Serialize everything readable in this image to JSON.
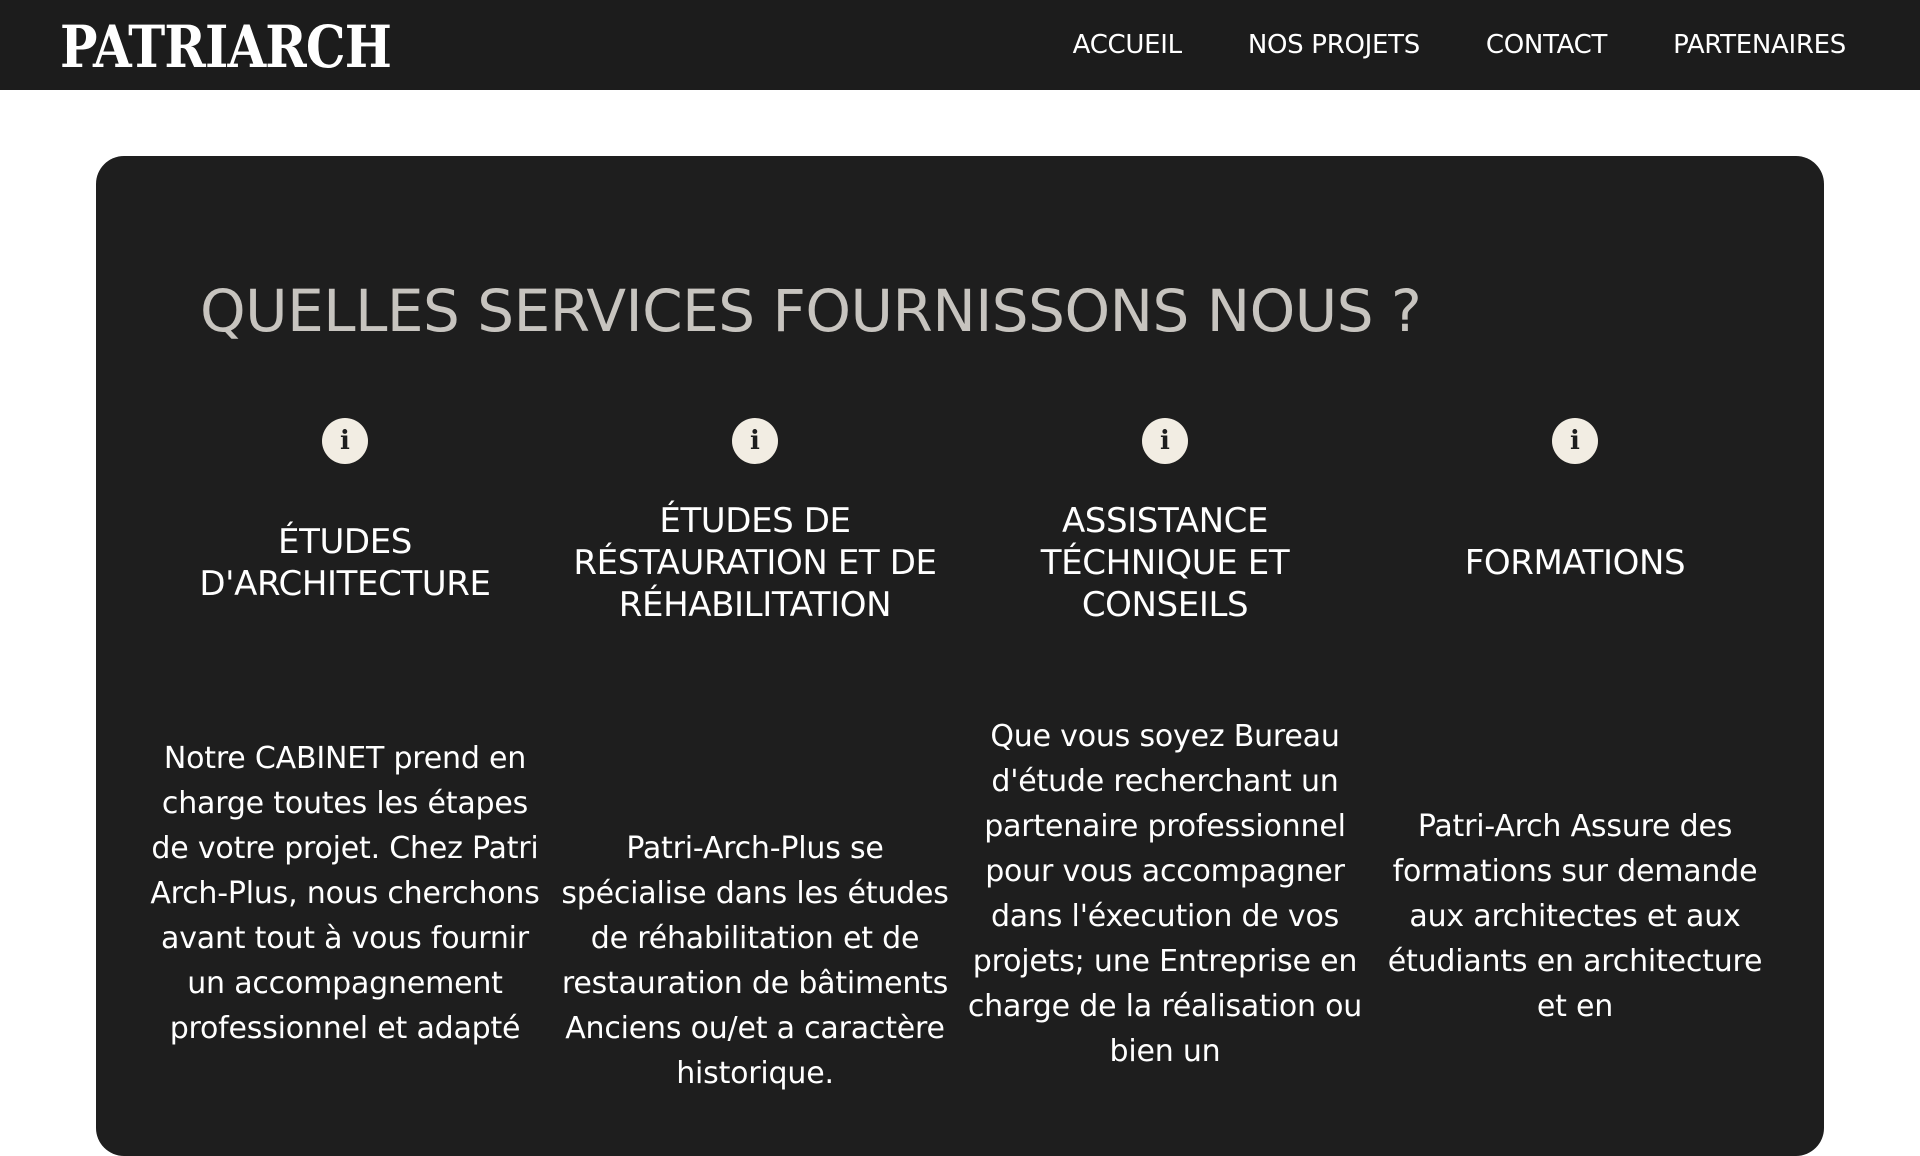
{
  "header": {
    "logo": "PATRIARCH",
    "nav": [
      "ACCUEIL",
      "NOS PROJETS",
      "CONTACT",
      "PARTENAIRES"
    ]
  },
  "services": {
    "title": "QUELLES SERVICES FOURNISSONS NOUS ?",
    "items": [
      {
        "icon": "info-icon",
        "title": "ÉTUDES D'ARCHITECTURE",
        "description": "Notre CABINET prend en charge toutes les étapes de votre projet. Chez Patri Arch-Plus, nous cherchons avant tout à vous fournir un accompagnement professionnel et adapté"
      },
      {
        "icon": "info-icon",
        "title": "ÉTUDES DE RÉSTAURATION ET DE RÉHABILITATION",
        "description": "Patri-Arch-Plus se spécialise dans les études de réhabilitation et de restauration de bâtiments Anciens ou/et a caractère historique."
      },
      {
        "icon": "info-icon",
        "title": "ASSISTANCE TÉCHNIQUE ET CONSEILS",
        "description": "Que vous soyez Bureau d'étude recherchant un partenaire professionnel pour vous accompagner dans l'éxecution de vos projets; une Entreprise en charge de la réalisation ou bien un"
      },
      {
        "icon": "info-icon",
        "title": "FORMATIONS",
        "description": "Patri-Arch Assure des formations sur demande aux architectes et aux étudiants en architecture et en"
      }
    ]
  }
}
